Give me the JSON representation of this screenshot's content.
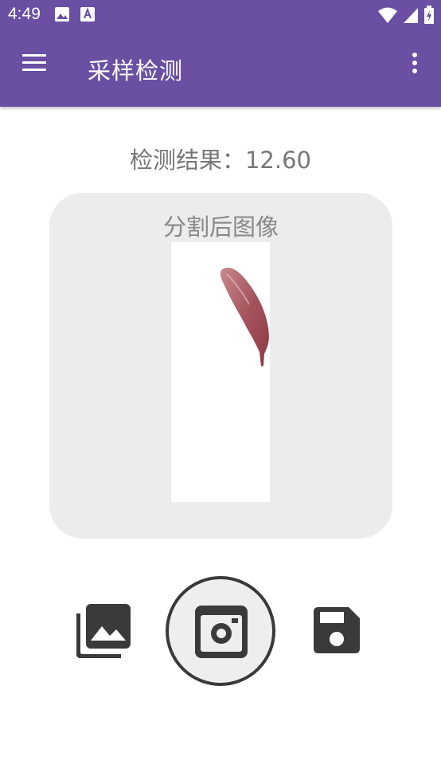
{
  "status_bar": {
    "time": "4:49",
    "icons": [
      "image-notification-icon",
      "text-notification-icon",
      "wifi-icon",
      "signal-icon",
      "battery-icon"
    ]
  },
  "app_bar": {
    "title": "采样检测",
    "icons": [
      "menu-icon",
      "more-vert-icon"
    ],
    "color": "#6a4fa3"
  },
  "main": {
    "result_label": "检测结果：",
    "result_value": "12.60",
    "image_card": {
      "title": "分割后图像"
    }
  },
  "controls": {
    "icons": [
      "photo-library-icon",
      "camera-icon",
      "save-icon"
    ]
  }
}
